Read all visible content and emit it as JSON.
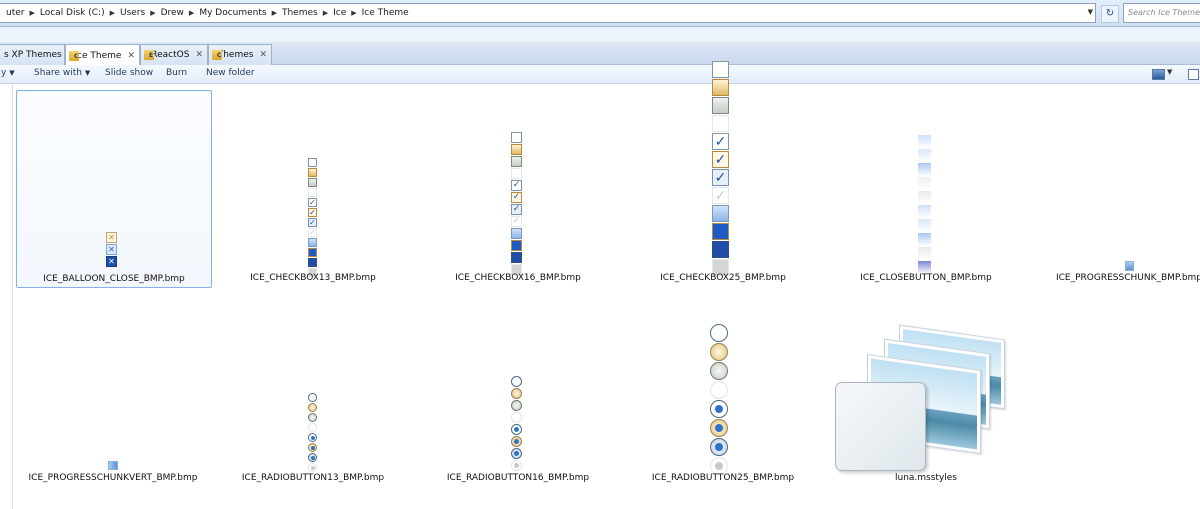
{
  "address_bar": {
    "breadcrumbs": [
      "uter",
      "Local Disk (C:)",
      "Users",
      "Drew",
      "My Documents",
      "Themes",
      "Ice",
      "Ice Theme"
    ],
    "search_placeholder": "Search Ice Theme"
  },
  "tabs": [
    {
      "label": "s XP Themes",
      "active": false,
      "icon": null
    },
    {
      "label": "Ice Theme",
      "active": true,
      "icon": "C"
    },
    {
      "label": "ReactOS",
      "active": false,
      "icon": "E"
    },
    {
      "label": "Themes",
      "active": false,
      "icon": "C"
    }
  ],
  "toolbar": {
    "organize_label": "y",
    "share_label": "Share with",
    "slideshow_label": "Slide show",
    "burn_label": "Burn",
    "newfolder_label": "New folder"
  },
  "files": [
    {
      "name": "ICE_BALLOON_CLOSE_BMP.bmp",
      "selected": true,
      "kind": "balloon"
    },
    {
      "name": "ICE_CHECKBOX13_BMP.bmp",
      "selected": false,
      "kind": "checkbox13"
    },
    {
      "name": "ICE_CHECKBOX16_BMP.bmp",
      "selected": false,
      "kind": "checkbox16"
    },
    {
      "name": "ICE_CHECKBOX25_BMP.bmp",
      "selected": false,
      "kind": "checkbox25"
    },
    {
      "name": "ICE_CLOSEBUTTON_BMP.bmp",
      "selected": false,
      "kind": "closebutton"
    },
    {
      "name": "ICE_PROGRESSCHUNK_BMP.bmp",
      "selected": false,
      "kind": "progresschunk"
    },
    {
      "name": "ICE_PROGRESSCHUNKVERT_BMP.bmp",
      "selected": false,
      "kind": "progresschunkvert"
    },
    {
      "name": "ICE_RADIOBUTTON13_BMP.bmp",
      "selected": false,
      "kind": "radio13"
    },
    {
      "name": "ICE_RADIOBUTTON16_BMP.bmp",
      "selected": false,
      "kind": "radio16"
    },
    {
      "name": "ICE_RADIOBUTTON25_BMP.bmp",
      "selected": false,
      "kind": "radio25"
    },
    {
      "name": "luna.msstyles",
      "selected": false,
      "kind": "msstyles"
    }
  ],
  "colors": {
    "selection_border": "#8bb0e4",
    "check_blue": "#1f4fa8",
    "tab_bar": "#cad9ee"
  }
}
